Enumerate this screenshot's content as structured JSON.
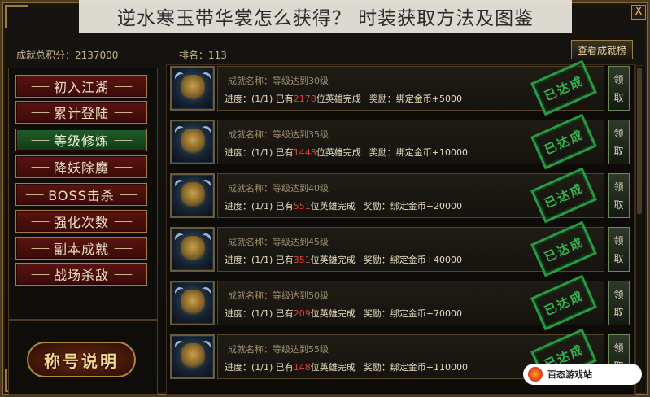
{
  "window": {
    "title": "逆水寒玉带华裳怎么获得？ 时装获取方法及图鉴",
    "close_label": "X"
  },
  "header": {
    "score_label": "成就总积分：2137000",
    "rank_label": "排名：113",
    "view_button": "查看成就榜"
  },
  "sidebar": {
    "dash": "——",
    "items": [
      {
        "label": "初入江湖",
        "active": false
      },
      {
        "label": "累计登陆",
        "active": false
      },
      {
        "label": "等级修炼",
        "active": true
      },
      {
        "label": "降妖除魔",
        "active": false
      },
      {
        "label": "BOSS击杀",
        "active": false
      },
      {
        "label": "强化次数",
        "active": false
      },
      {
        "label": "副本成就",
        "active": false
      },
      {
        "label": "战场杀敌",
        "active": false
      }
    ],
    "title_button": "称号说明"
  },
  "achievements": {
    "stamp": "已达成",
    "claim": [
      "领",
      "取"
    ],
    "rows": [
      {
        "name": "成就名称：等级达到30级",
        "progress_prefix": "进度：(1/1) 已有",
        "count": "2178",
        "progress_suffix": "位英雄完成",
        "reward": "奖励：绑定金币+5000"
      },
      {
        "name": "成就名称：等级达到35级",
        "progress_prefix": "进度：(1/1) 已有",
        "count": "1448",
        "progress_suffix": "位英雄完成",
        "reward": "奖励：绑定金币+10000"
      },
      {
        "name": "成就名称：等级达到40级",
        "progress_prefix": "进度：(1/1) 已有",
        "count": "551",
        "progress_suffix": "位英雄完成",
        "reward": "奖励：绑定金币+20000"
      },
      {
        "name": "成就名称：等级达到45级",
        "progress_prefix": "进度：(1/1) 已有",
        "count": "351",
        "progress_suffix": "位英雄完成",
        "reward": "奖励：绑定金币+40000"
      },
      {
        "name": "成就名称：等级达到50级",
        "progress_prefix": "进度：(1/1) 已有",
        "count": "209",
        "progress_suffix": "位英雄完成",
        "reward": "奖励：绑定金币+70000"
      },
      {
        "name": "成就名称：等级达到55级",
        "progress_prefix": "进度：(1/1) 已有",
        "count": "148",
        "progress_suffix": "位英雄完成",
        "reward": "奖励：绑定金币+110000"
      }
    ]
  },
  "watermark": {
    "text": "百态游戏站"
  },
  "colors": {
    "count_highlight": "#e04040",
    "stamp_green": "#39c35a",
    "active_tab": "#1f5e2a",
    "inactive_tab": "#5a1410"
  }
}
